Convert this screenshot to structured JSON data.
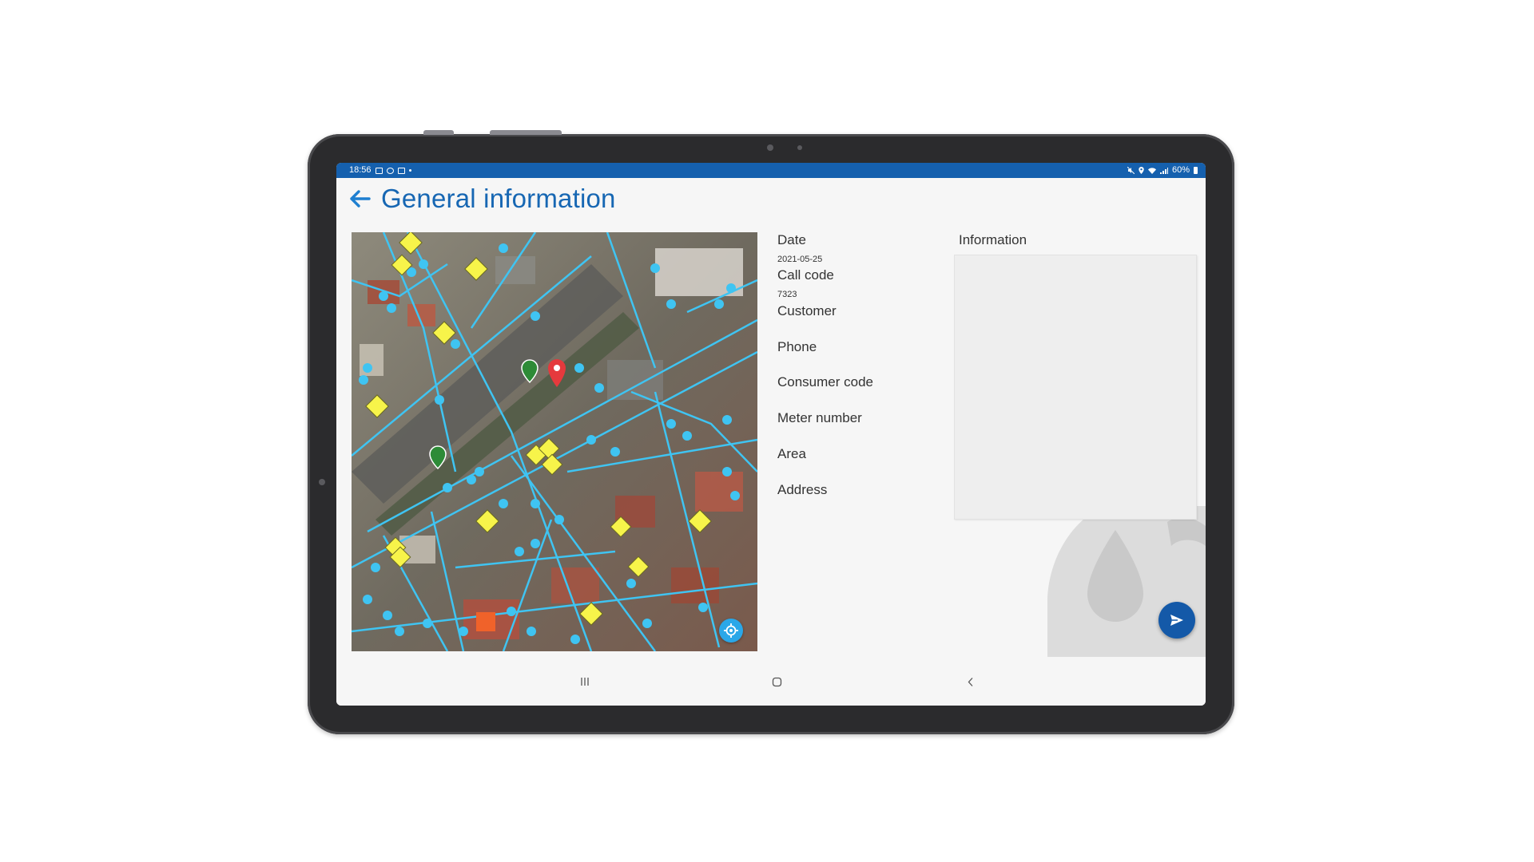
{
  "status_bar": {
    "time": "18:56",
    "battery": "60%",
    "left_icons": [
      "gallery-icon",
      "notification-icon",
      "notification-icon",
      "dot-icon"
    ],
    "right_icons": [
      "mute-icon",
      "location-icon",
      "wifi-icon",
      "signal-icon",
      "battery-icon"
    ],
    "color": "#1560ae"
  },
  "header": {
    "back_icon": "arrow-left-icon",
    "title": "General information",
    "accent": "#1767b3"
  },
  "map": {
    "locate_icon": "crosshair-icon",
    "pin_icon": "map-pin-icon",
    "layer_colors": {
      "pipes": "#3fc4f2",
      "valves": "#f7f44a",
      "pin": "#e53a3d",
      "marker": "#f0622a"
    }
  },
  "fields": [
    {
      "label": "Date",
      "value": "2021-05-25"
    },
    {
      "label": "Call code",
      "value": "7323"
    },
    {
      "label": "Customer",
      "value": ""
    },
    {
      "label": "Phone",
      "value": ""
    },
    {
      "label": "Consumer code",
      "value": ""
    },
    {
      "label": "Meter number",
      "value": ""
    },
    {
      "label": "Area",
      "value": ""
    },
    {
      "label": "Address",
      "value": ""
    }
  ],
  "information": {
    "label": "Information",
    "value": ""
  },
  "send_button": {
    "icon": "send-icon",
    "color": "#1459a8"
  },
  "nav_bar": {
    "recent_icon": "recent-apps-icon",
    "home_icon": "home-icon",
    "back_icon": "chevron-left-icon"
  }
}
